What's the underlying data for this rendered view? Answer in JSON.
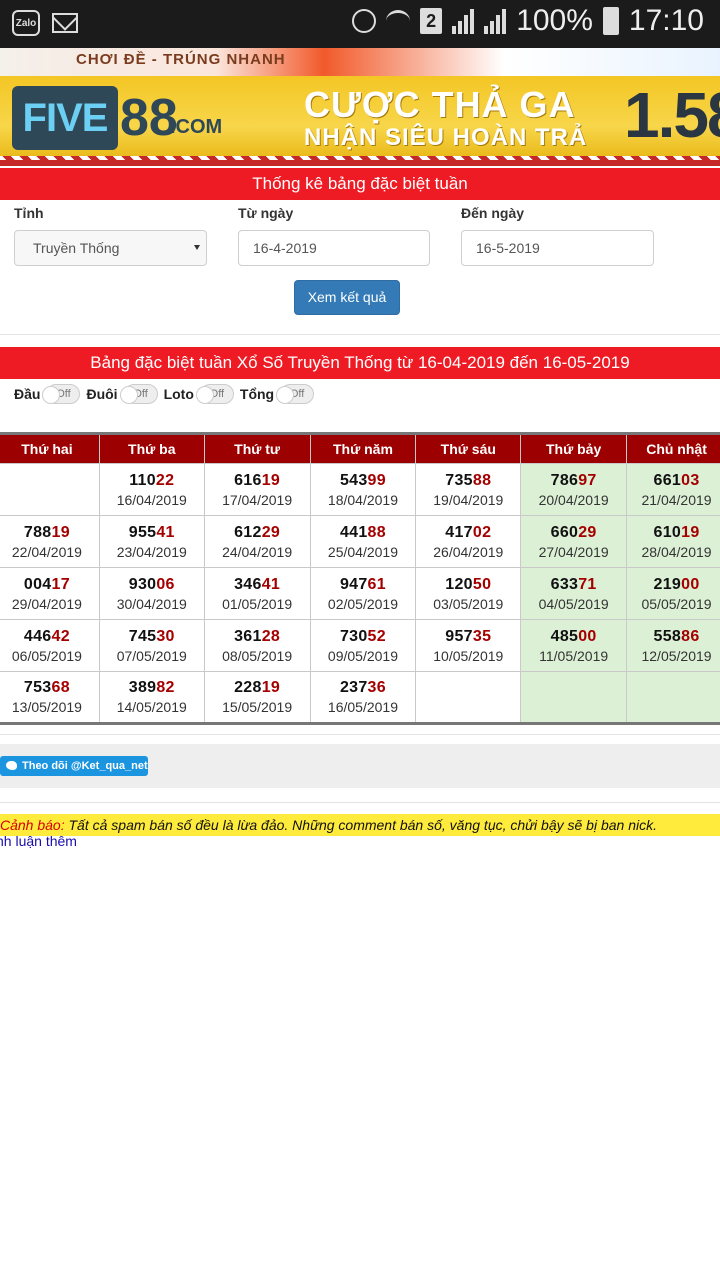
{
  "status_bar": {
    "app_icons": [
      "Zalo",
      "mail-icon"
    ],
    "sim_badge": "2",
    "battery": "100%",
    "time": "17:10"
  },
  "banner_top": {
    "slogan": "CHƠI ĐỀ - TRÚNG NHANH"
  },
  "banner_ad": {
    "logo_five": "FIVE",
    "logo_88": "88",
    "logo_com": ".COM",
    "line1": "CƯỢC THẢ GA",
    "line2": "NHẬN SIÊU HOÀN TRẢ",
    "number": "1.58"
  },
  "filter": {
    "header": "Thống kê bảng đặc biệt tuần",
    "province_label": "Tỉnh",
    "province_value": "Truyền Thống",
    "from_label": "Từ ngày",
    "from_value": "16-4-2019",
    "to_label": "Đến ngày",
    "to_value": "16-5-2019",
    "submit_label": "Xem kết quả"
  },
  "results": {
    "header": "Bảng đặc biệt tuần Xổ Số Truyền Thống từ 16-04-2019 đến 16-05-2019",
    "toggles": [
      {
        "label": "Đầu",
        "state": "Off"
      },
      {
        "label": "Đuôi",
        "state": "Off"
      },
      {
        "label": "Loto",
        "state": "Off"
      },
      {
        "label": "Tổng",
        "state": "Off"
      }
    ],
    "columns": [
      "Thứ hai",
      "Thứ ba",
      "Thứ tư",
      "Thứ năm",
      "Thứ sáu",
      "Thứ bảy",
      "Chủ nhật"
    ],
    "rows": [
      [
        null,
        {
          "head": "110",
          "tail": "22",
          "date": "16/04/2019"
        },
        {
          "head": "616",
          "tail": "19",
          "date": "17/04/2019"
        },
        {
          "head": "543",
          "tail": "99",
          "date": "18/04/2019"
        },
        {
          "head": "735",
          "tail": "88",
          "date": "19/04/2019"
        },
        {
          "head": "786",
          "tail": "97",
          "date": "20/04/2019"
        },
        {
          "head": "661",
          "tail": "03",
          "date": "21/04/2019"
        }
      ],
      [
        {
          "head": "788",
          "tail": "19",
          "date": "22/04/2019"
        },
        {
          "head": "955",
          "tail": "41",
          "date": "23/04/2019"
        },
        {
          "head": "612",
          "tail": "29",
          "date": "24/04/2019"
        },
        {
          "head": "441",
          "tail": "88",
          "date": "25/04/2019"
        },
        {
          "head": "417",
          "tail": "02",
          "date": "26/04/2019"
        },
        {
          "head": "660",
          "tail": "29",
          "date": "27/04/2019"
        },
        {
          "head": "610",
          "tail": "19",
          "date": "28/04/2019"
        }
      ],
      [
        {
          "head": "004",
          "tail": "17",
          "date": "29/04/2019"
        },
        {
          "head": "930",
          "tail": "06",
          "date": "30/04/2019"
        },
        {
          "head": "346",
          "tail": "41",
          "date": "01/05/2019"
        },
        {
          "head": "947",
          "tail": "61",
          "date": "02/05/2019"
        },
        {
          "head": "120",
          "tail": "50",
          "date": "03/05/2019"
        },
        {
          "head": "633",
          "tail": "71",
          "date": "04/05/2019"
        },
        {
          "head": "219",
          "tail": "00",
          "date": "05/05/2019"
        }
      ],
      [
        {
          "head": "446",
          "tail": "42",
          "date": "06/05/2019"
        },
        {
          "head": "745",
          "tail": "30",
          "date": "07/05/2019"
        },
        {
          "head": "361",
          "tail": "28",
          "date": "08/05/2019"
        },
        {
          "head": "730",
          "tail": "52",
          "date": "09/05/2019"
        },
        {
          "head": "957",
          "tail": "35",
          "date": "10/05/2019"
        },
        {
          "head": "485",
          "tail": "00",
          "date": "11/05/2019"
        },
        {
          "head": "558",
          "tail": "86",
          "date": "12/05/2019"
        }
      ],
      [
        {
          "head": "753",
          "tail": "68",
          "date": "13/05/2019"
        },
        {
          "head": "389",
          "tail": "82",
          "date": "14/05/2019"
        },
        {
          "head": "228",
          "tail": "19",
          "date": "15/05/2019"
        },
        {
          "head": "237",
          "tail": "36",
          "date": "16/05/2019"
        },
        null,
        null,
        null
      ]
    ]
  },
  "social": {
    "twitter_follow": "Theo dõi @Ket_qua_net"
  },
  "notice": {
    "label": "Cảnh báo:",
    "text": " Tất cả spam bán số đều là lừa đảo. Những comment bán số, văng tục, chửi bậy sẽ bị ban nick.",
    "more_comments": "nh luận thêm"
  },
  "colors": {
    "red_bar": "#ee1b24",
    "table_header": "#9c0000",
    "weekend_cell": "#dcf0d6",
    "tail_digits": "#a40000",
    "button_blue": "#337ab7",
    "warning_bg": "#ffeb3b"
  }
}
